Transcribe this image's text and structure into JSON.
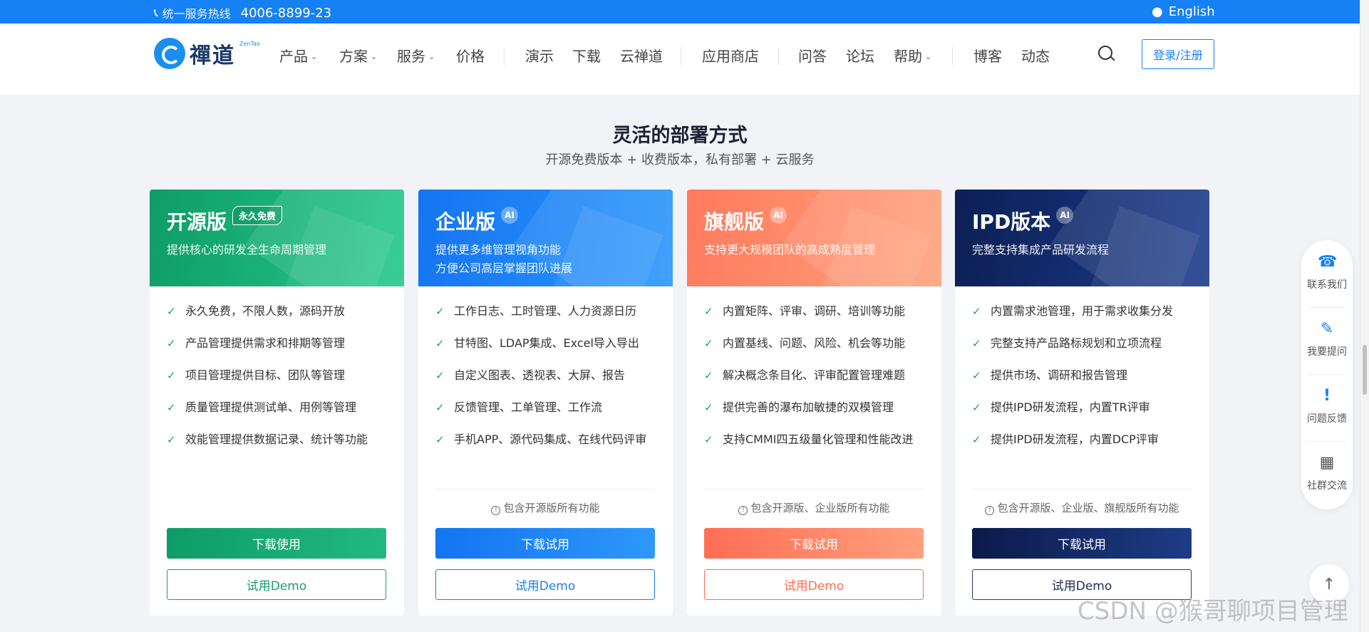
{
  "topbar": {
    "hotline_label": "统一服务热线",
    "hotline_number": "4006-8899-23",
    "language": "English"
  },
  "nav": {
    "logo_text": "禪道",
    "logo_tiny": "ZenTao",
    "items": [
      {
        "label": "产品",
        "dropdown": true
      },
      {
        "label": "方案",
        "dropdown": true
      },
      {
        "label": "服务",
        "dropdown": true
      },
      {
        "label": "价格",
        "dropdown": false
      },
      {
        "label": "演示",
        "dropdown": false
      },
      {
        "label": "下载",
        "dropdown": false
      },
      {
        "label": "云禅道",
        "dropdown": false
      },
      {
        "label": "应用商店",
        "dropdown": false
      },
      {
        "label": "问答",
        "dropdown": false
      },
      {
        "label": "论坛",
        "dropdown": false
      },
      {
        "label": "帮助",
        "dropdown": true
      },
      {
        "label": "博客",
        "dropdown": false
      },
      {
        "label": "动态",
        "dropdown": false
      }
    ],
    "login_label": "登录/注册"
  },
  "section": {
    "title": "灵活的部署方式",
    "subtitle": "开源免费版本 + 收费版本，私有部署 + 云服务"
  },
  "cards": [
    {
      "name": "开源版",
      "badge": "永久免费",
      "desc": "提供核心的研发全生命周期管理",
      "features": [
        "永久免费，不限人数，源码开放",
        "产品管理提供需求和排期等管理",
        "项目管理提供目标、团队等管理",
        "质量管理提供测试单、用例等管理",
        "效能管理提供数据记录、统计等功能"
      ],
      "note": "",
      "primary_button": "下载使用",
      "secondary_button": "试用Demo"
    },
    {
      "name": "企业版",
      "badge": "AI",
      "desc": "提供更多维管理视角功能\n方便公司高层掌握团队进展",
      "features": [
        "工作日志、工时管理、人力资源日历",
        "甘特图、LDAP集成、Excel导入导出",
        "自定义图表、透视表、大屏、报告",
        "反馈管理、工单管理、工作流",
        "手机APP、源代码集成、在线代码评审"
      ],
      "note": "包含开源版所有功能",
      "primary_button": "下载试用",
      "secondary_button": "试用Demo"
    },
    {
      "name": "旗舰版",
      "badge": "AI",
      "desc": "支持更大规模团队的高成熟度管理",
      "features": [
        "内置矩阵、评审、调研、培训等功能",
        "内置基线、问题、风险、机会等功能",
        "解决概念条目化、评审配置管理难题",
        "提供完善的瀑布加敏捷的双模管理",
        "支持CMMI四五级量化管理和性能改进"
      ],
      "note": "包含开源版、企业版所有功能",
      "primary_button": "下载试用",
      "secondary_button": "试用Demo"
    },
    {
      "name": "IPD版本",
      "badge": "AI",
      "desc": "完整支持集成产品研发流程",
      "features": [
        "内置需求池管理，用于需求收集分发",
        "完整支持产品路标规划和立项流程",
        "提供市场、调研和报告管理",
        "提供IPD研发流程，内置TR评审",
        "提供IPD研发流程，内置DCP评审"
      ],
      "note": "包含开源版、企业版、旗舰版所有功能",
      "primary_button": "下载试用",
      "secondary_button": "试用Demo"
    }
  ],
  "float_panel": [
    {
      "label": "联系我们",
      "icon": "phone-icon"
    },
    {
      "label": "我要提问",
      "icon": "edit-icon"
    },
    {
      "label": "问题反馈",
      "icon": "feedback-icon"
    },
    {
      "label": "社群交流",
      "icon": "qrcode-icon"
    }
  ],
  "watermark": "CSDN @猴哥聊项目管理"
}
